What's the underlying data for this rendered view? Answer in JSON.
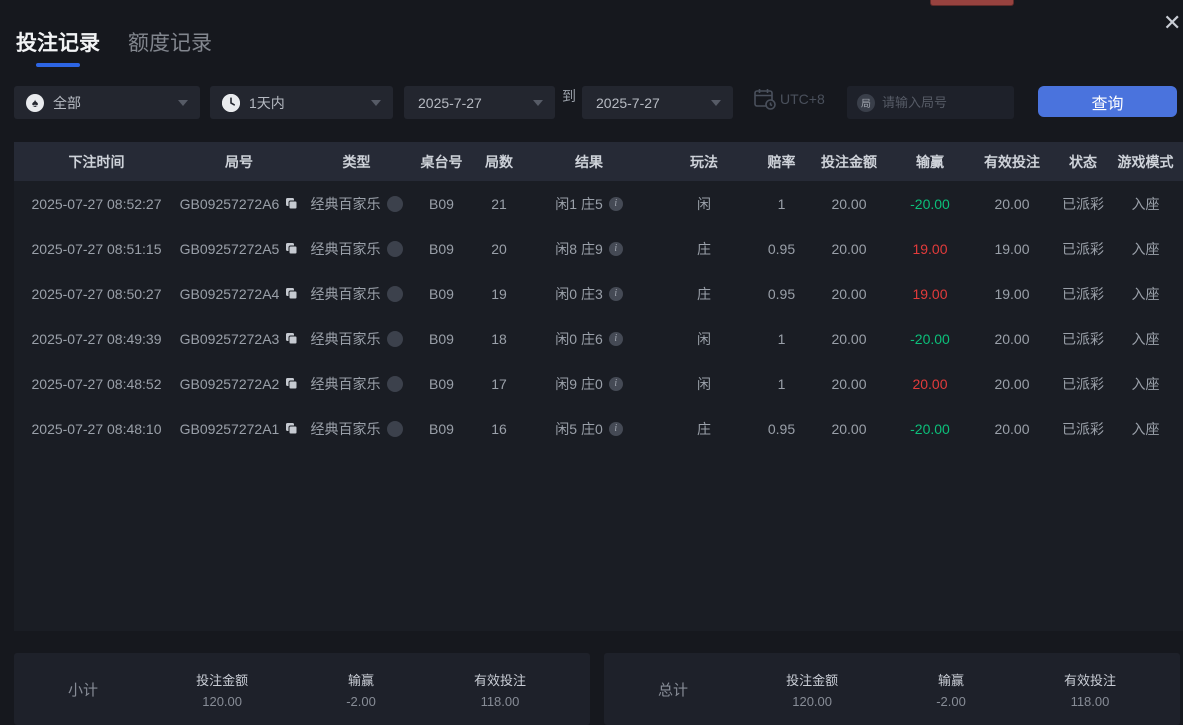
{
  "tabs": [
    {
      "label": "投注记录",
      "active": true
    },
    {
      "label": "额度记录",
      "active": false
    }
  ],
  "filters": {
    "game_type": {
      "value": "全部"
    },
    "time_range": {
      "value": "1天内"
    },
    "date_from": "2025-7-27",
    "to_label": "到",
    "date_to": "2025-7-27",
    "timezone": "UTC+8",
    "round_input": {
      "placeholder": "请输入局号"
    },
    "search_button": "查询"
  },
  "icons": {
    "spade": "♠",
    "close": "✕",
    "info": "i",
    "round_badge": "局",
    "clock": "white-circle-clock",
    "copy": "overlapping-squares",
    "calendar_utc": "calendar-with-clock"
  },
  "table": {
    "headers": [
      "下注时间",
      "局号",
      "类型",
      "桌台号",
      "局数",
      "结果",
      "玩法",
      "赔率",
      "投注金额",
      "输赢",
      "有效投注",
      "状态",
      "游戏模式"
    ],
    "rows": [
      {
        "time": "2025-07-27 08:52:27",
        "round_id": "GB09257272A6",
        "type": "经典百家乐",
        "table_no": "B09",
        "round": "21",
        "result": "闲1 庄5",
        "play": "闲",
        "odds": "1",
        "bet": "20.00",
        "win_loss": "-20.00",
        "win_loss_color": "green",
        "valid": "20.00",
        "status": "已派彩",
        "mode": "入座"
      },
      {
        "time": "2025-07-27 08:51:15",
        "round_id": "GB09257272A5",
        "type": "经典百家乐",
        "table_no": "B09",
        "round": "20",
        "result": "闲8 庄9",
        "play": "庄",
        "odds": "0.95",
        "bet": "20.00",
        "win_loss": "19.00",
        "win_loss_color": "red",
        "valid": "19.00",
        "status": "已派彩",
        "mode": "入座"
      },
      {
        "time": "2025-07-27 08:50:27",
        "round_id": "GB09257272A4",
        "type": "经典百家乐",
        "table_no": "B09",
        "round": "19",
        "result": "闲0 庄3",
        "play": "庄",
        "odds": "0.95",
        "bet": "20.00",
        "win_loss": "19.00",
        "win_loss_color": "red",
        "valid": "19.00",
        "status": "已派彩",
        "mode": "入座"
      },
      {
        "time": "2025-07-27 08:49:39",
        "round_id": "GB09257272A3",
        "type": "经典百家乐",
        "table_no": "B09",
        "round": "18",
        "result": "闲0 庄6",
        "play": "闲",
        "odds": "1",
        "bet": "20.00",
        "win_loss": "-20.00",
        "win_loss_color": "green",
        "valid": "20.00",
        "status": "已派彩",
        "mode": "入座"
      },
      {
        "time": "2025-07-27 08:48:52",
        "round_id": "GB09257272A2",
        "type": "经典百家乐",
        "table_no": "B09",
        "round": "17",
        "result": "闲9 庄0",
        "play": "闲",
        "odds": "1",
        "bet": "20.00",
        "win_loss": "20.00",
        "win_loss_color": "red",
        "valid": "20.00",
        "status": "已派彩",
        "mode": "入座"
      },
      {
        "time": "2025-07-27 08:48:10",
        "round_id": "GB09257272A1",
        "type": "经典百家乐",
        "table_no": "B09",
        "round": "16",
        "result": "闲5 庄0",
        "play": "庄",
        "odds": "0.95",
        "bet": "20.00",
        "win_loss": "-20.00",
        "win_loss_color": "green",
        "valid": "20.00",
        "status": "已派彩",
        "mode": "入座"
      }
    ]
  },
  "summary": {
    "subtotal": {
      "title": "小计",
      "stats": [
        {
          "label": "投注金额",
          "value": "120.00",
          "color": ""
        },
        {
          "label": "输赢",
          "value": "-2.00",
          "color": "green"
        },
        {
          "label": "有效投注",
          "value": "118.00",
          "color": ""
        }
      ]
    },
    "total": {
      "title": "总计",
      "stats": [
        {
          "label": "投注金额",
          "value": "120.00",
          "color": ""
        },
        {
          "label": "输赢",
          "value": "-2.00",
          "color": "green"
        },
        {
          "label": "有效投注",
          "value": "118.00",
          "color": ""
        }
      ]
    }
  },
  "colors": {
    "accent": "#4a73dd",
    "tab_underline": "#2d65e4",
    "win": "#e23b3b",
    "loss": "#0cbf7a"
  }
}
